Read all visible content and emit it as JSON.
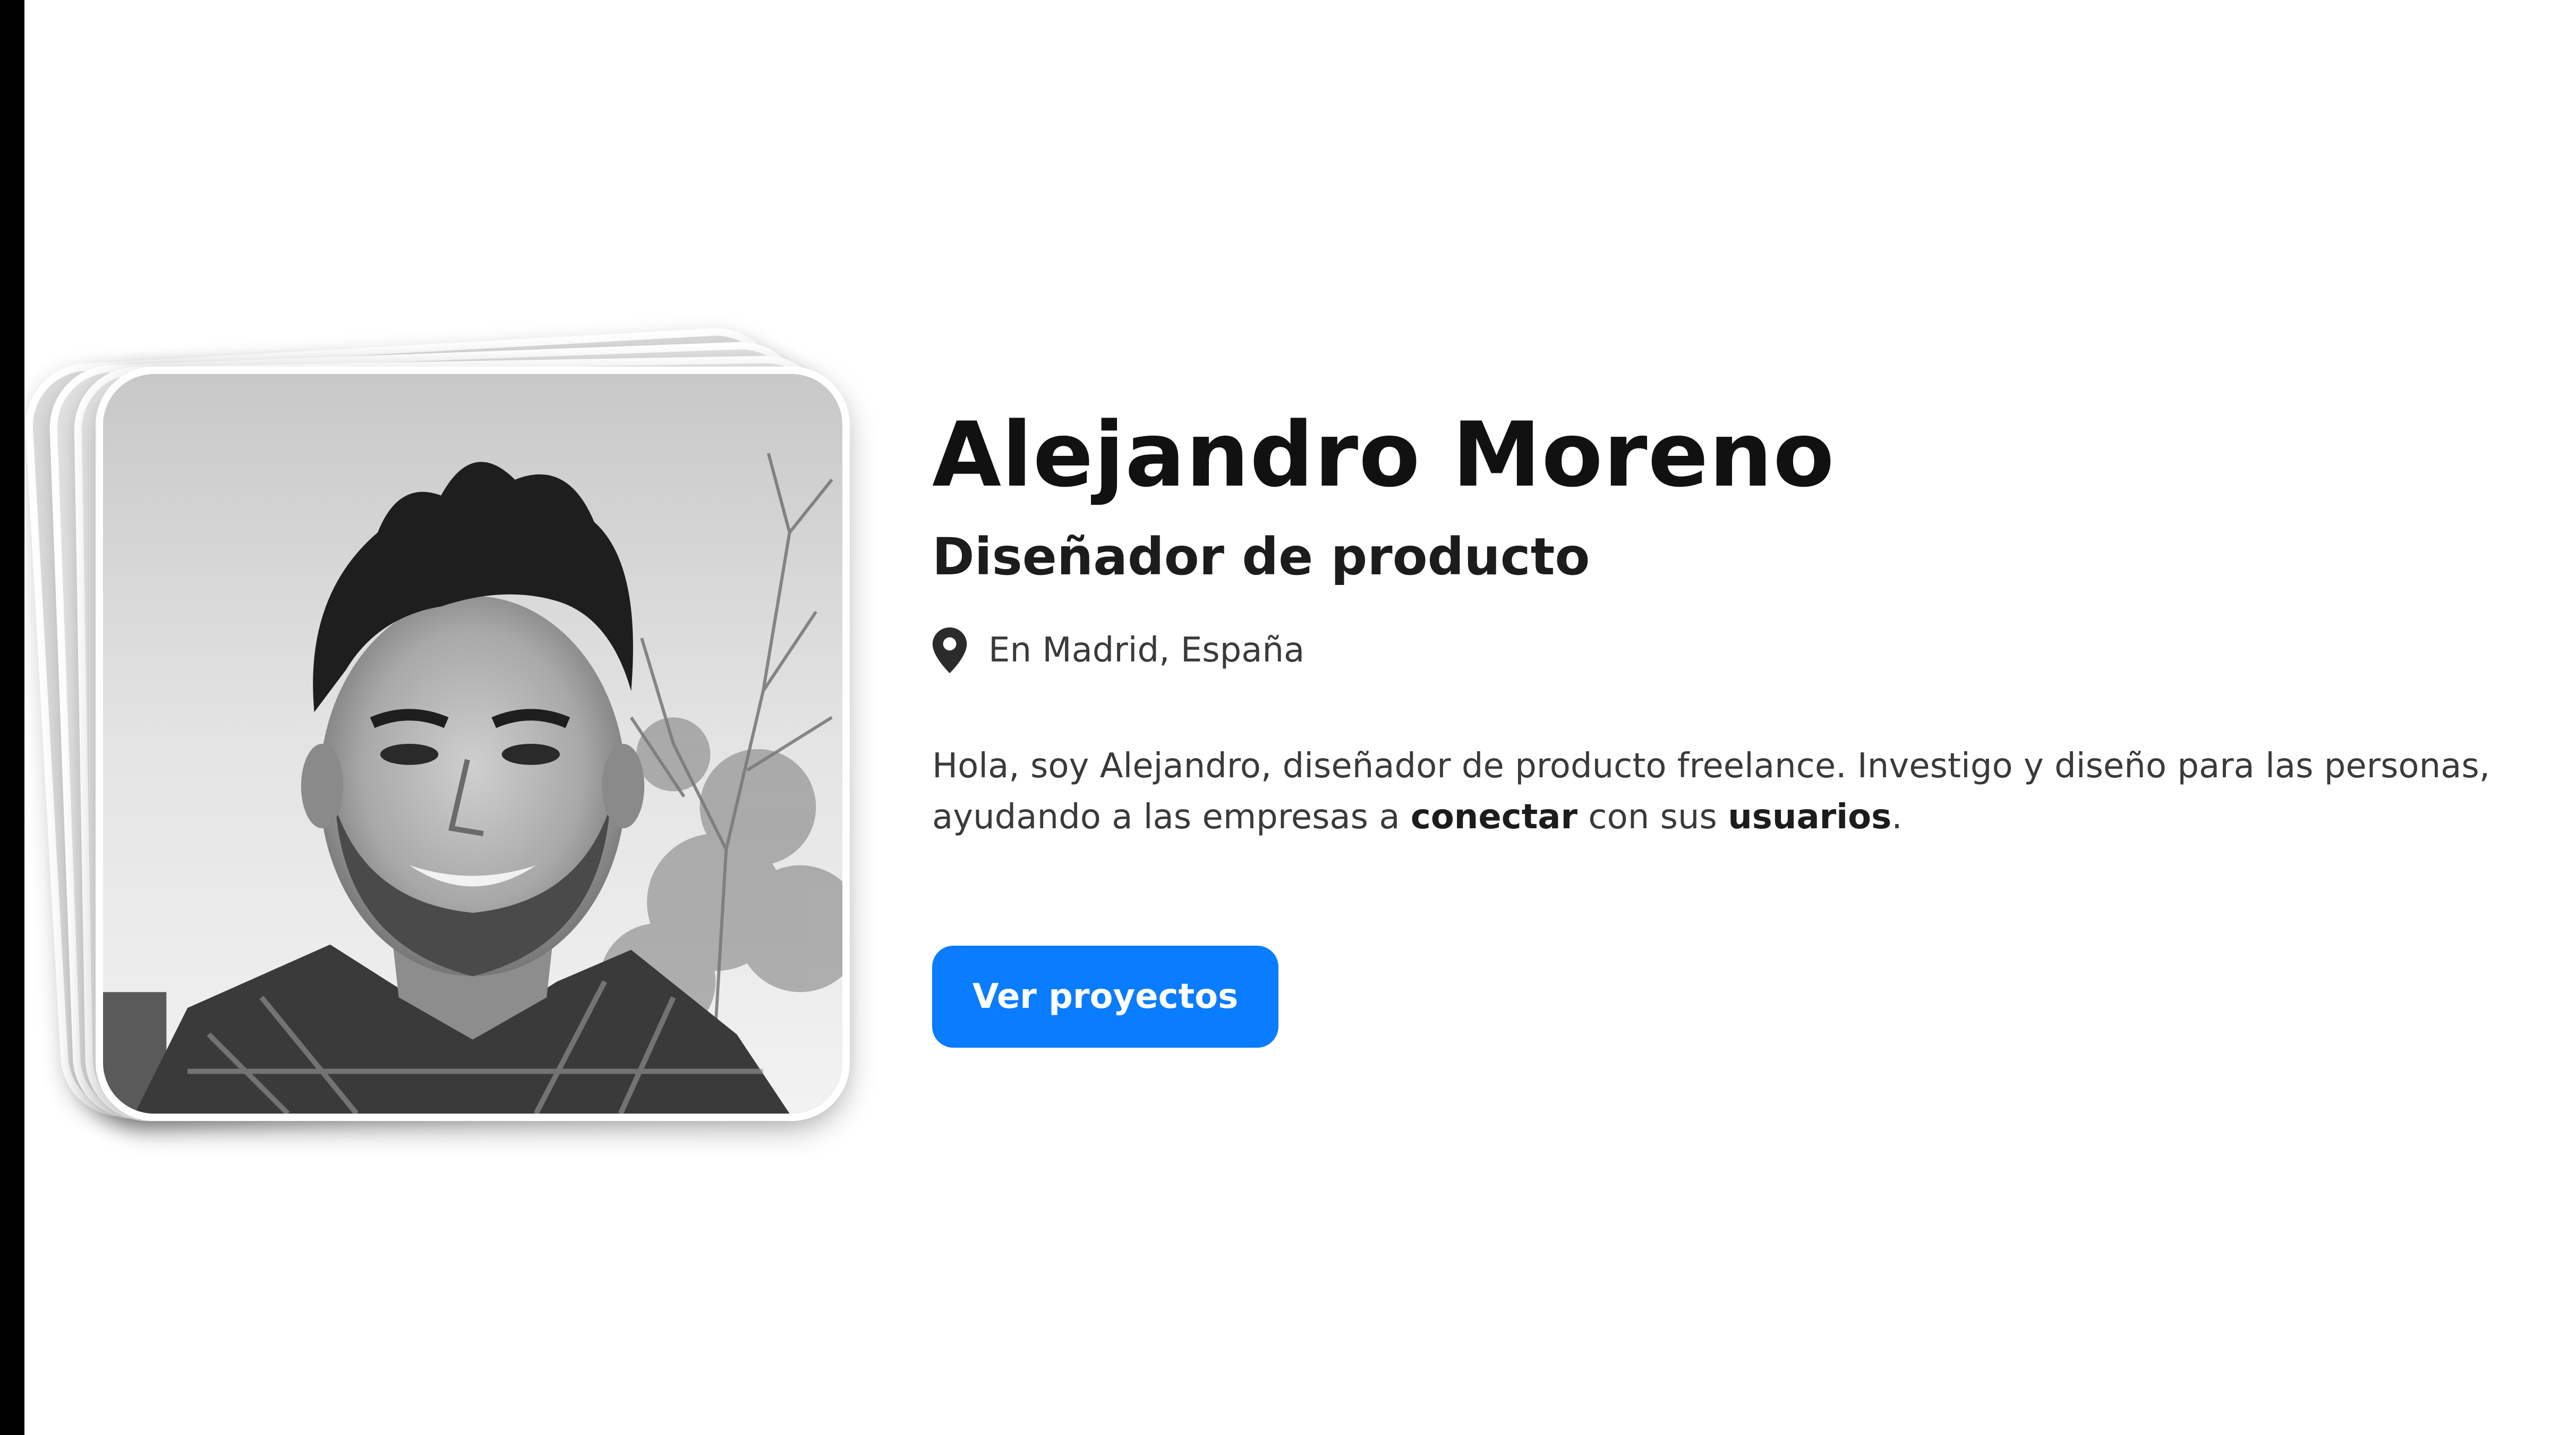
{
  "profile": {
    "name": "Alejandro Moreno",
    "role": "Diseñador de producto",
    "location": "En Madrid, España",
    "location_icon": "map-pin-icon",
    "bio": {
      "part1": "Hola, soy Alejandro, diseñador de producto freelance. Investigo y diseño para las personas, ayudando a las empresas a ",
      "bold1": "conectar",
      "part2": " con sus ",
      "bold2": "usuarios",
      "part3": "."
    }
  },
  "cta": {
    "label": "Ver proyectos",
    "color": "#0a7cff"
  },
  "photo": {
    "style": "grayscale portrait",
    "stack_count": 4
  }
}
